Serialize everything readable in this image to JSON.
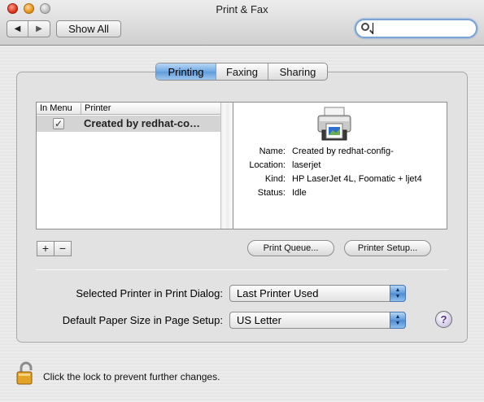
{
  "window": {
    "title": "Print & Fax",
    "toolbar": {
      "back_arrow": "◀",
      "forward_arrow": "▶",
      "show_all_label": "Show All",
      "search_value": ""
    }
  },
  "tabs": {
    "items": [
      {
        "label": "Printing",
        "active": true
      },
      {
        "label": "Faxing",
        "active": false
      },
      {
        "label": "Sharing",
        "active": false
      }
    ]
  },
  "printer_list": {
    "columns": [
      "In Menu",
      "Printer"
    ],
    "rows": [
      {
        "in_menu": "✓",
        "name": "Created by redhat-co…"
      }
    ]
  },
  "printer_details": {
    "icon": "printer-icon",
    "fields": [
      {
        "key": "Name:",
        "value": "Created by redhat-config-"
      },
      {
        "key": "Location:",
        "value": "laserjet"
      },
      {
        "key": "Kind:",
        "value": "HP LaserJet 4L, Foomatic + ljet4"
      },
      {
        "key": "Status:",
        "value": "Idle"
      }
    ]
  },
  "list_buttons": {
    "add": "+",
    "remove": "−"
  },
  "actions": {
    "print_queue": "Print Queue...",
    "printer_setup": "Printer Setup..."
  },
  "settings": {
    "selected_printer_label": "Selected Printer in Print Dialog:",
    "selected_printer_value": "Last Printer Used",
    "paper_size_label": "Default Paper Size in Page Setup:",
    "paper_size_value": "US Letter"
  },
  "help": "?",
  "lock_message": "Click the lock to prevent further changes.",
  "colors": {
    "accent": "#6ea9e4",
    "help_glyph": "#5b2e91"
  }
}
